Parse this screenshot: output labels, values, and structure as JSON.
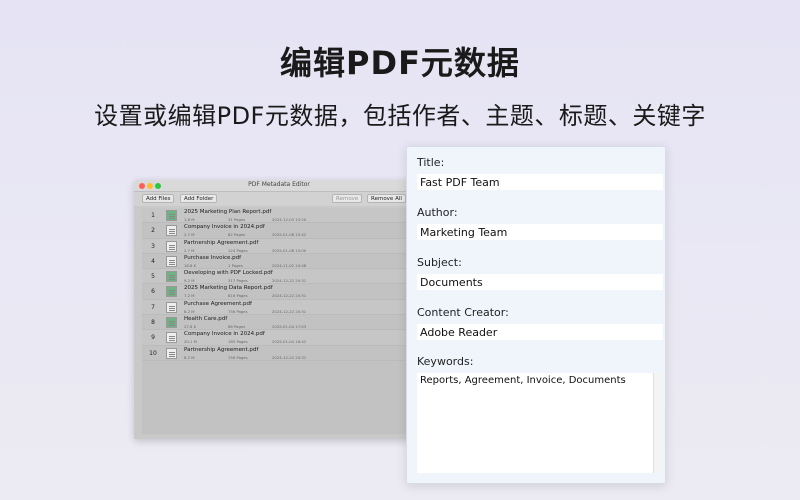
{
  "hero": {
    "title": "编辑PDF元数据",
    "subtitle": "设置或编辑PDF元数据，包括作者、主题、标题、关键字"
  },
  "window": {
    "title": "PDF Metadata Editor",
    "toolbar": {
      "add_files": "Add Files",
      "add_folder": "Add Folder",
      "remove": "Remove",
      "remove_all": "Remove All"
    },
    "files": [
      {
        "index": "1",
        "name": "2025 Marketing Plan Report.pdf",
        "size": "1.8 M",
        "pages": "31 Pages",
        "date": "2024-12-03 15:20",
        "thumb": "green"
      },
      {
        "index": "2",
        "name": "Company Invoice in 2024.pdf",
        "size": "2.7 M",
        "pages": "82 Pages",
        "date": "2025-01-08 15:42",
        "thumb": "doc"
      },
      {
        "index": "3",
        "name": "Partnership Agreement.pdf",
        "size": "2.7 M",
        "pages": "124 Pages",
        "date": "2025-01-08 15:00",
        "thumb": "doc"
      },
      {
        "index": "4",
        "name": "Purchase Invoice.pdf",
        "size": "18.8 K",
        "pages": "1 Pages",
        "date": "2024-11-02 10:48",
        "thumb": "doc"
      },
      {
        "index": "5",
        "name": "Developing with PDF Locked.pdf",
        "size": "9.2 M",
        "pages": "317 Pages",
        "date": "2024-12-22 20:31",
        "thumb": "green"
      },
      {
        "index": "6",
        "name": "2025 Marketing Data Report.pdf",
        "size": "7.2 M",
        "pages": "816 Pages",
        "date": "2024-12-22 20:31",
        "thumb": "green"
      },
      {
        "index": "7",
        "name": "Purchase Agreement.pdf",
        "size": "8.2 M",
        "pages": "756 Pages",
        "date": "2024-12-22 20:31",
        "thumb": "doc"
      },
      {
        "index": "8",
        "name": "Health Care.pdf",
        "size": "27.8 K",
        "pages": "86 Pages",
        "date": "2025-01-04 17:03",
        "thumb": "green"
      },
      {
        "index": "9",
        "name": "Company Invoice in 2024.pdf",
        "size": "20.1 M",
        "pages": "185 Pages",
        "date": "2025-01-04 16:42",
        "thumb": "doc"
      },
      {
        "index": "10",
        "name": "Partnership Agreement.pdf",
        "size": "8.2 M",
        "pages": "756 Pages",
        "date": "2024-12-22 20:31",
        "thumb": "doc"
      }
    ]
  },
  "metadata": {
    "title_label": "Title:",
    "title_value": "Fast PDF Team",
    "author_label": "Author:",
    "author_value": "Marketing Team",
    "subject_label": "Subject:",
    "subject_value": "Documents",
    "creator_label": "Content Creator:",
    "creator_value": "Adobe Reader",
    "keywords_label": "Keywords:",
    "keywords_value": "Reports, Agreement, Invoice, Documents"
  }
}
